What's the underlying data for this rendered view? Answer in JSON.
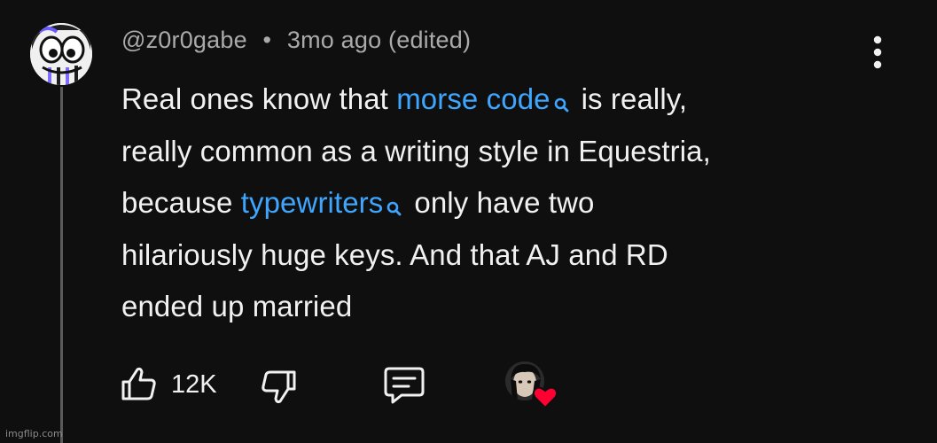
{
  "comment": {
    "author": "@z0r0gabe",
    "separator": "•",
    "timestamp": "3mo ago (edited)",
    "lines": {
      "l1_before": "Real ones know that ",
      "l1_link": "morse code",
      "l1_after": "is really,",
      "l2": "really common as a writing style in Equestria,",
      "l3_before": "because ",
      "l3_link": "typewriters",
      "l3_after": "only have two",
      "l4": "hilariously huge keys. And that AJ and RD",
      "l5": "ended up married"
    }
  },
  "actions": {
    "like_count": "12K"
  },
  "watermark": "imgflip.com",
  "colors": {
    "background": "#0f0f0f",
    "text": "#f1f1f1",
    "muted": "#aaaaaa",
    "link": "#3ea6ff",
    "heart": "#ff0033"
  },
  "icons": {
    "avatar": "cartoon-pony-face-avatar",
    "menu": "vertical-ellipsis-icon",
    "link_search": "search-icon",
    "like": "thumbs-up-icon",
    "dislike": "thumbs-down-icon",
    "reply": "comment-icon",
    "creator_heart": "heart-icon"
  }
}
